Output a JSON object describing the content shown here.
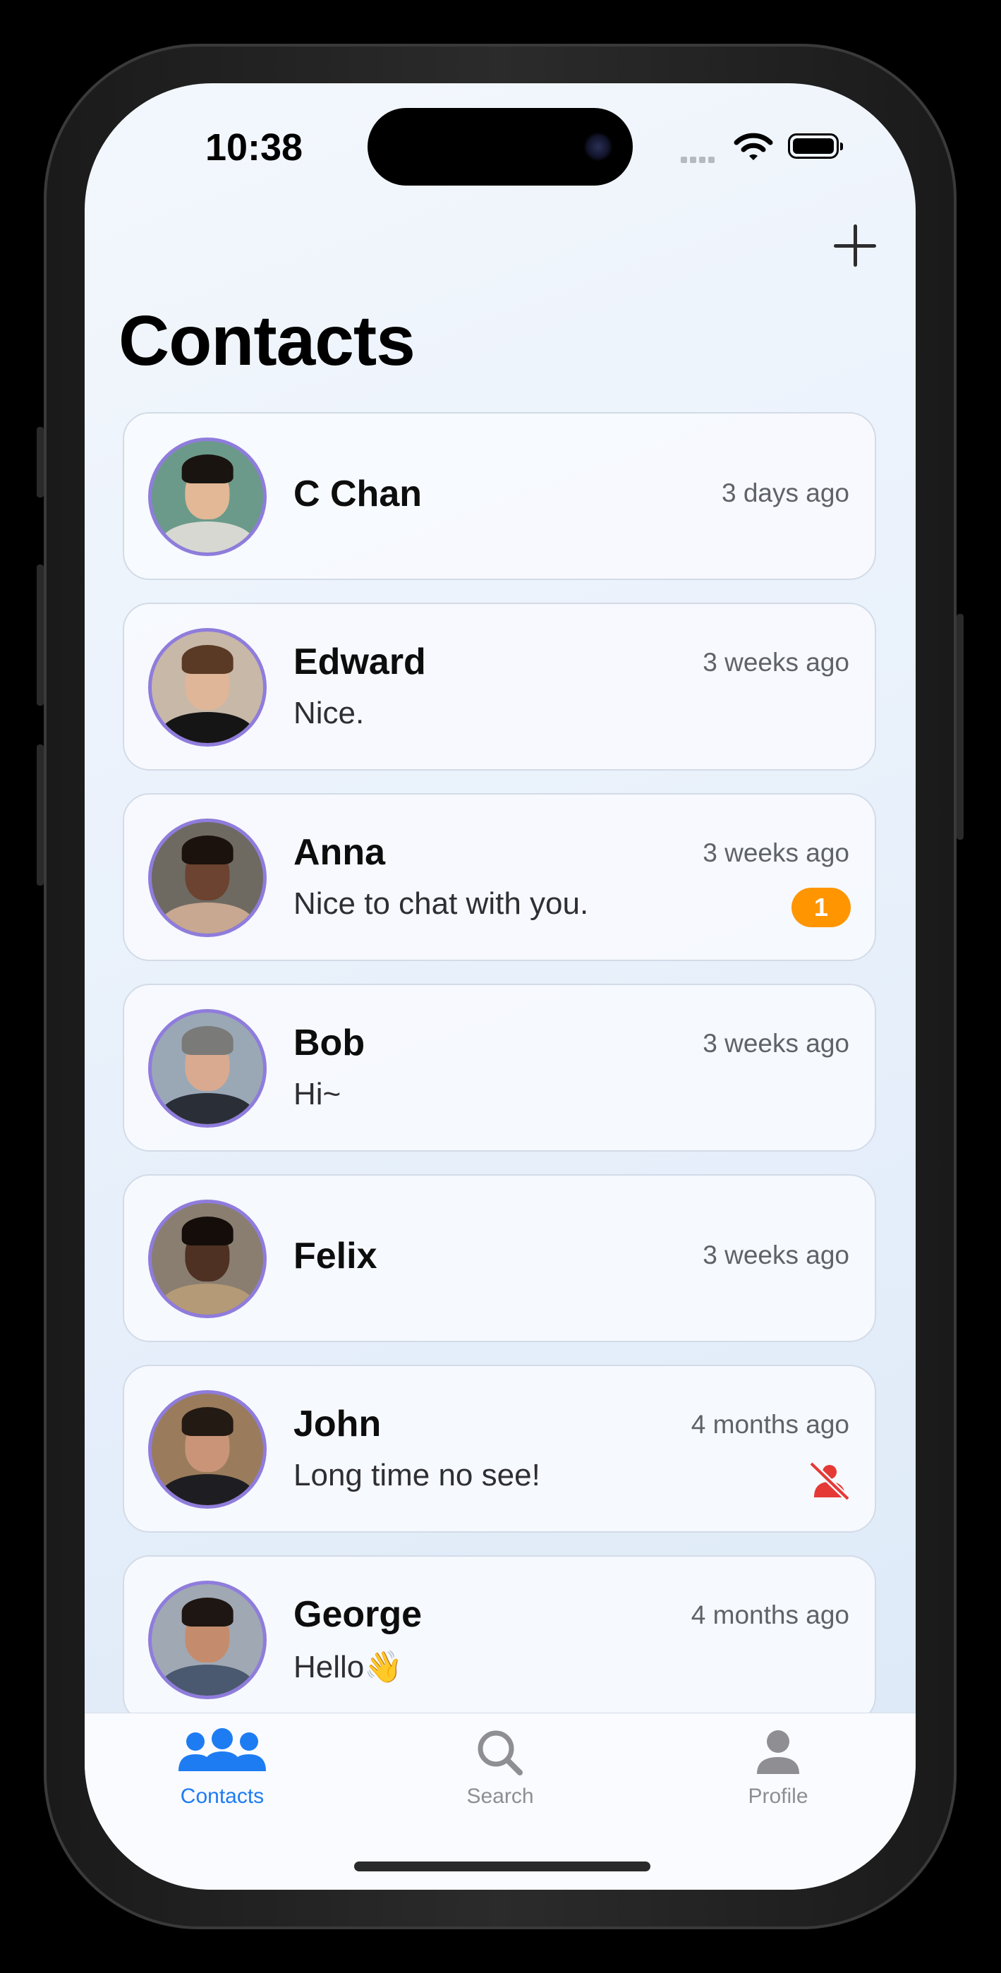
{
  "status_bar": {
    "time": "10:38"
  },
  "header": {
    "title": "Contacts",
    "add_icon": "plus-icon"
  },
  "contacts": [
    {
      "name": "C Chan",
      "time": "3 days ago",
      "message": "",
      "badge": "",
      "muted": false,
      "avatar": {
        "bg": "#6b9a8a",
        "skin": "#e2b896",
        "hair": "#1a1410",
        "shirt": "#d8d8d2"
      }
    },
    {
      "name": "Edward",
      "time": "3 weeks ago",
      "message": "Nice.",
      "badge": "",
      "muted": false,
      "avatar": {
        "bg": "#c8b8a8",
        "skin": "#e0b698",
        "hair": "#5a3a24",
        "shirt": "#151515"
      }
    },
    {
      "name": "Anna",
      "time": "3 weeks ago",
      "message": "Nice to chat with you.",
      "badge": "1",
      "muted": false,
      "avatar": {
        "bg": "#6e6a62",
        "skin": "#6b4330",
        "hair": "#1b120d",
        "shirt": "#c8a890"
      }
    },
    {
      "name": "Bob",
      "time": "3 weeks ago",
      "message": "Hi~",
      "badge": "",
      "muted": false,
      "avatar": {
        "bg": "#9aa8b6",
        "skin": "#d9aa90",
        "hair": "#7a7a78",
        "shirt": "#2a2e36"
      }
    },
    {
      "name": "Felix",
      "time": "3 weeks ago",
      "message": "",
      "badge": "",
      "muted": false,
      "avatar": {
        "bg": "#8a7e70",
        "skin": "#4e3122",
        "hair": "#140d0a",
        "shirt": "#b49a76"
      }
    },
    {
      "name": "John",
      "time": "4 months ago",
      "message": "Long time no see!",
      "badge": "",
      "muted": true,
      "avatar": {
        "bg": "#9a7c5c",
        "skin": "#c99478",
        "hair": "#241a14",
        "shirt": "#1e1e22"
      }
    },
    {
      "name": "George",
      "time": "4 months ago",
      "message": "Hello👋",
      "badge": "",
      "muted": false,
      "avatar": {
        "bg": "#a0a8b4",
        "skin": "#c48c6c",
        "hair": "#1e1612",
        "shirt": "#4a5870"
      }
    }
  ],
  "tabs": [
    {
      "label": "Contacts",
      "icon": "people-icon",
      "active": true
    },
    {
      "label": "Search",
      "icon": "search-icon",
      "active": false
    },
    {
      "label": "Profile",
      "icon": "person-icon",
      "active": false
    }
  ],
  "colors": {
    "accent": "#1e7cf2",
    "badge": "#ff9500",
    "muted": "#e53935",
    "avatar_ring": "#8f7cdc",
    "inactive_tab": "#8e8e93"
  }
}
